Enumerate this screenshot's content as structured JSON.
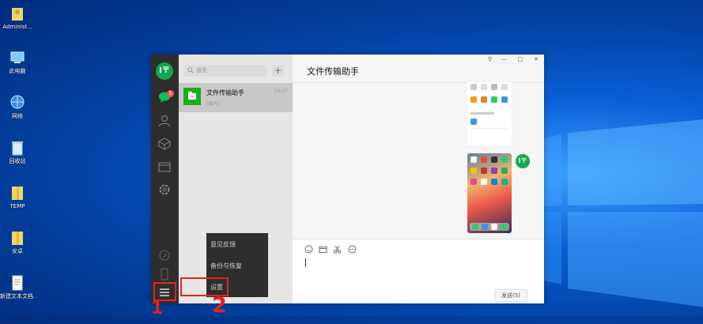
{
  "desktop": {
    "icons": [
      {
        "label": "Administ...",
        "icon": "user-folder-icon"
      },
      {
        "label": "此电脑",
        "icon": "computer-icon"
      },
      {
        "label": "网络",
        "icon": "network-icon"
      },
      {
        "label": "回收站",
        "icon": "recycle-bin-icon"
      },
      {
        "label": "TEMP",
        "icon": "folder-icon"
      },
      {
        "label": "安卓",
        "icon": "folder-icon"
      },
      {
        "label": "新建文本文档.txt",
        "icon": "text-file-icon"
      }
    ]
  },
  "app": {
    "rail": {
      "avatar_text": "I〒",
      "chat_badge": "5"
    },
    "list": {
      "search_placeholder": "搜索",
      "add_label": "+",
      "chat": {
        "name": "文件传输助手",
        "time": "10:27",
        "preview": "[图片]"
      }
    },
    "menu": {
      "items": [
        "意见反馈",
        "备份与恢复",
        "设置"
      ]
    },
    "main": {
      "title": "文件传输助手",
      "send_label": "发送(S)",
      "window_controls": [
        "pin-icon",
        "minimize-icon",
        "maximize-icon",
        "close-icon"
      ]
    }
  },
  "annotations": {
    "one": "1",
    "two": "2"
  },
  "colors": {
    "accent": "#12a84c",
    "highlight": "#e12323",
    "rail": "#2e2e2e"
  }
}
